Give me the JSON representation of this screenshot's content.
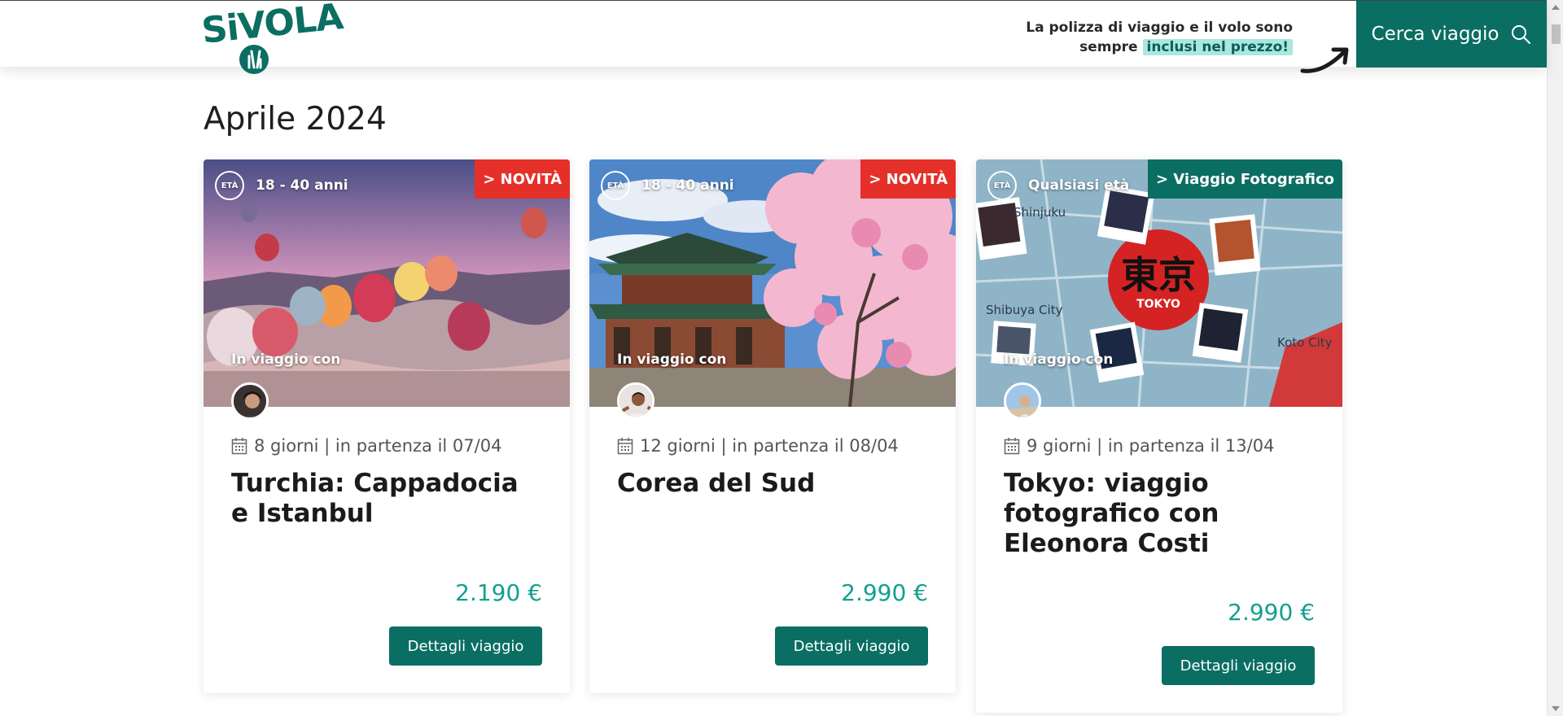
{
  "header": {
    "logo_text": "SiVOLA",
    "promo_line1": "La polizza di viaggio e il volo sono",
    "promo_line2_prefix": "sempre",
    "promo_highlight": "inclusi nel prezzo!",
    "search_label": "Cerca viaggio",
    "colors": {
      "brand": "#0b6e63",
      "highlight": "#a9e7e0"
    }
  },
  "section": {
    "title": "Aprile 2024"
  },
  "cards": [
    {
      "age": "18 - 40 anni",
      "age_icon_label": "ETÀ",
      "badge": "> NOVITÀ",
      "with_label": "In viaggio con",
      "meta": "8 giorni | in partenza il 07/04",
      "title": "Turchia: Cappadocia e Istanbul",
      "price": "2.190 €",
      "button": "Dettagli viaggio",
      "image": "hot-air-balloons-cappadocia"
    },
    {
      "age": "18 - 40 anni",
      "age_icon_label": "ETÀ",
      "badge": "> NOVITÀ",
      "with_label": "In viaggio con",
      "meta": "12 giorni | in partenza il 08/04",
      "title": "Corea del Sud",
      "price": "2.990 €",
      "button": "Dettagli viaggio",
      "image": "korean-palace-cherry-blossoms"
    },
    {
      "age": "Qualsiasi età",
      "age_icon_label": "ETÀ",
      "badge": "> Viaggio Fotografico",
      "with_label": "In viaggio con",
      "meta": "9 giorni | in partenza il 13/04",
      "title": "Tokyo: viaggio fotografico con Eleonora Costi",
      "price": "2.990 €",
      "button": "Dettagli viaggio",
      "image": "tokyo-map-collage"
    }
  ]
}
